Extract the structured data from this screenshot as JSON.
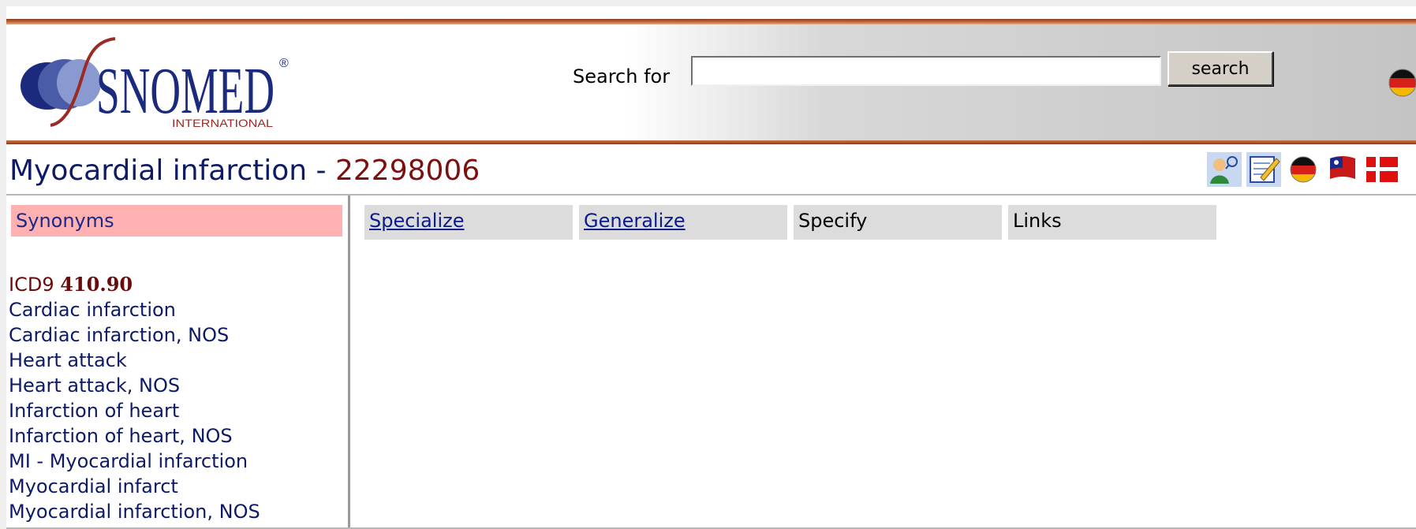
{
  "header": {
    "logo": {
      "text": "SNOMED",
      "registered": "®",
      "subtext": "INTERNATIONAL"
    },
    "search": {
      "label": "Search for",
      "value": "",
      "placeholder": "",
      "button_label": "search"
    }
  },
  "concept": {
    "name": "Myocardial infarction",
    "separator": " - ",
    "id": "22298006"
  },
  "icons": [
    "user-search-icon",
    "edit-note-icon",
    "german-flag-icon",
    "taiwan-flag-icon",
    "danish-flag-icon"
  ],
  "left_panel": {
    "header": "Synonyms",
    "icd": {
      "label": "ICD9",
      "code": "410.90"
    },
    "synonyms": [
      "Cardiac infarction",
      "Cardiac infarction, NOS",
      "Heart attack",
      "Heart attack, NOS",
      "Infarction of heart",
      "Infarction of heart, NOS",
      "MI - Myocardial infarction",
      "Myocardial infarct",
      "Myocardial infarction, NOS"
    ]
  },
  "tabs": [
    {
      "label": "Specialize",
      "link": true
    },
    {
      "label": "Generalize",
      "link": true
    },
    {
      "label": "Specify",
      "link": false
    },
    {
      "label": "Links",
      "link": false
    }
  ],
  "colors": {
    "accent_rule": "#8a3a20",
    "title_blue": "#0d1a66",
    "concept_id_red": "#7a1010",
    "synonyms_header_bg": "#ffb0b0",
    "tab_bg": "#dcdcdc"
  }
}
